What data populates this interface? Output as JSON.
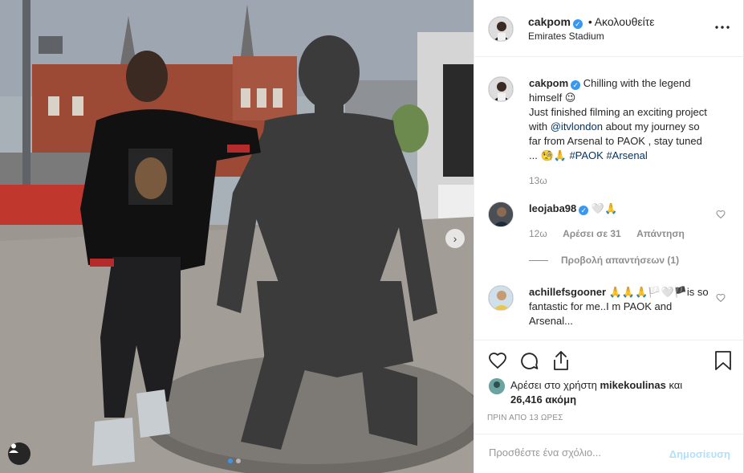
{
  "post": {
    "username": "cakpom",
    "follow_separator": "•",
    "follow_label": "Ακολουθείτε",
    "location": "Emirates Stadium",
    "more_icon": "more-horizontal-icon"
  },
  "caption": {
    "username": "cakpom",
    "line1": "Chilling with the legend himself 😉",
    "line2_pre": "Just finished filming an exciting project with ",
    "line2_mention": "@itvlondon",
    "line2_post": " about my journey so far from Arsenal to PAOK , stay tuned ... 🧐🙏 ",
    "hashtag1": "#PAOK",
    "hashtag2": "#Arsenal",
    "time": "13ω"
  },
  "comments": [
    {
      "username": "leojaba98",
      "text": "🤍🙏",
      "time": "12ω",
      "likes": "Αρέσει σε 31",
      "reply": "Απάντηση",
      "view_replies": "Προβολή απαντήσεων (1)"
    },
    {
      "username": "achillefsgooner",
      "text": "🙏🙏🙏🏳️🤍🏴is so fantastic for me..I m PAOK and Arsenal..."
    }
  ],
  "likes": {
    "prefix": "Αρέσει στο χρήστη ",
    "user": "mikekoulinas",
    "mid": " και",
    "count": "26,416 ακόμη",
    "timestamp": "ΠΡΙΝ ΑΠΟ 13 ΩΡΕΣ"
  },
  "add_comment": {
    "placeholder": "Προσθέστε ένα σχόλιο...",
    "post_label": "Δημοσίευση"
  },
  "colors": {
    "accent": "#3897f0",
    "link": "#003569",
    "post_button_disabled": "#b2dffc"
  }
}
